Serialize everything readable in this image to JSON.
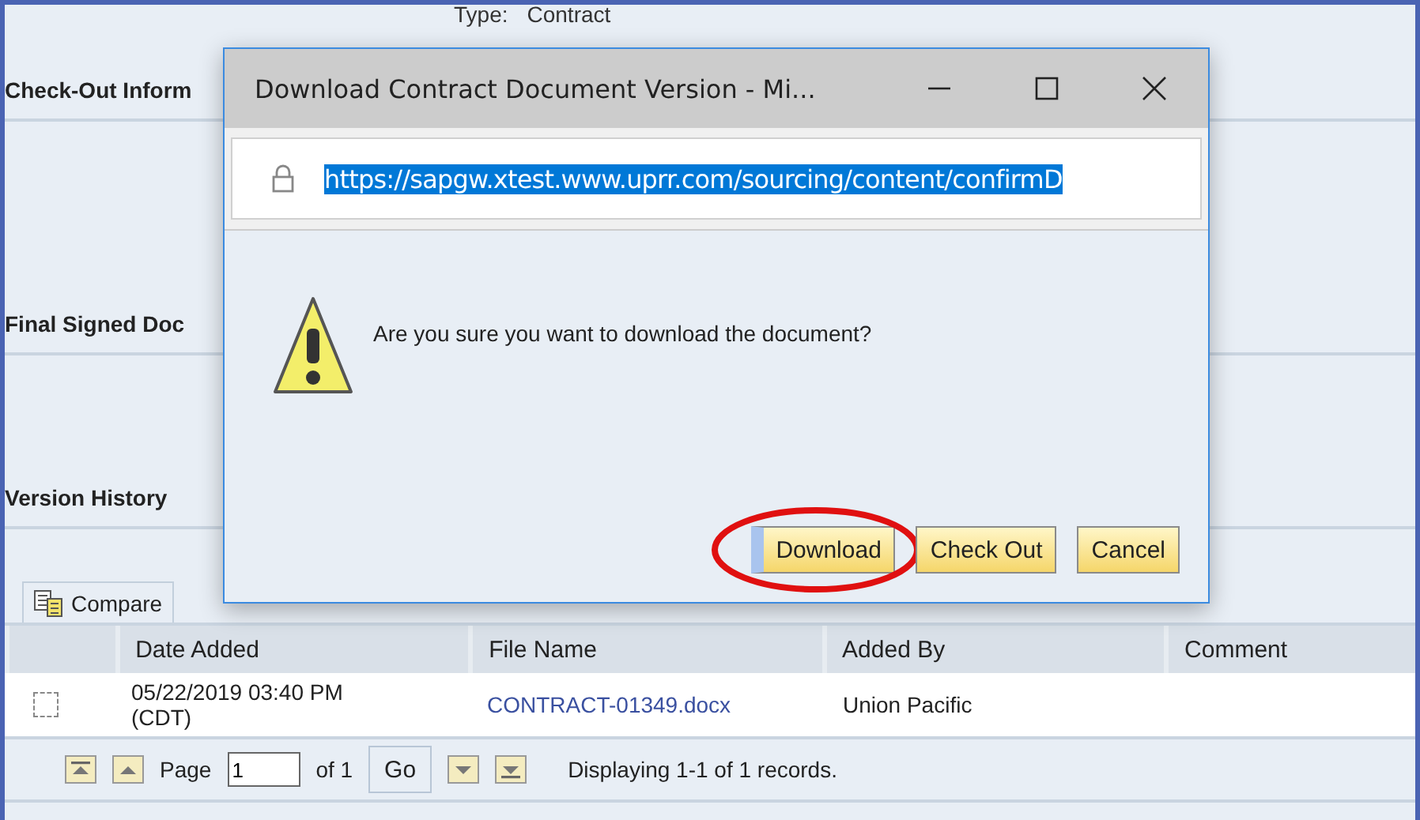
{
  "page": {
    "type_label": "Type:",
    "type_value": "Contract",
    "sections": [
      "Check-Out Inform",
      "Final Signed Doc",
      "Version History"
    ]
  },
  "toolbar": {
    "compare": "Compare"
  },
  "table": {
    "columns": [
      "Date Added",
      "File Name",
      "Added By",
      "Comment"
    ],
    "rows": [
      {
        "checked": false,
        "date_added": "05/22/2019 03:40 PM (CDT)",
        "file_name": "CONTRACT-01349.docx",
        "added_by": "Union Pacific"
      }
    ]
  },
  "pager": {
    "page_label": "Page",
    "page_value": "1",
    "of": "of 1",
    "go": "Go",
    "status": "Displaying 1-1 of 1 records."
  },
  "dialog": {
    "title": "Download Contract Document Version - Mi...",
    "url": "https://sapgw.xtest.www.uprr.com/sourcing/content/confirmD",
    "url_selected": true,
    "message": "Are you sure you want to download the document?",
    "buttons": [
      {
        "label": "Download",
        "focused": true
      },
      {
        "label": "Check Out",
        "focused": false
      },
      {
        "label": "Cancel",
        "focused": false
      }
    ]
  }
}
